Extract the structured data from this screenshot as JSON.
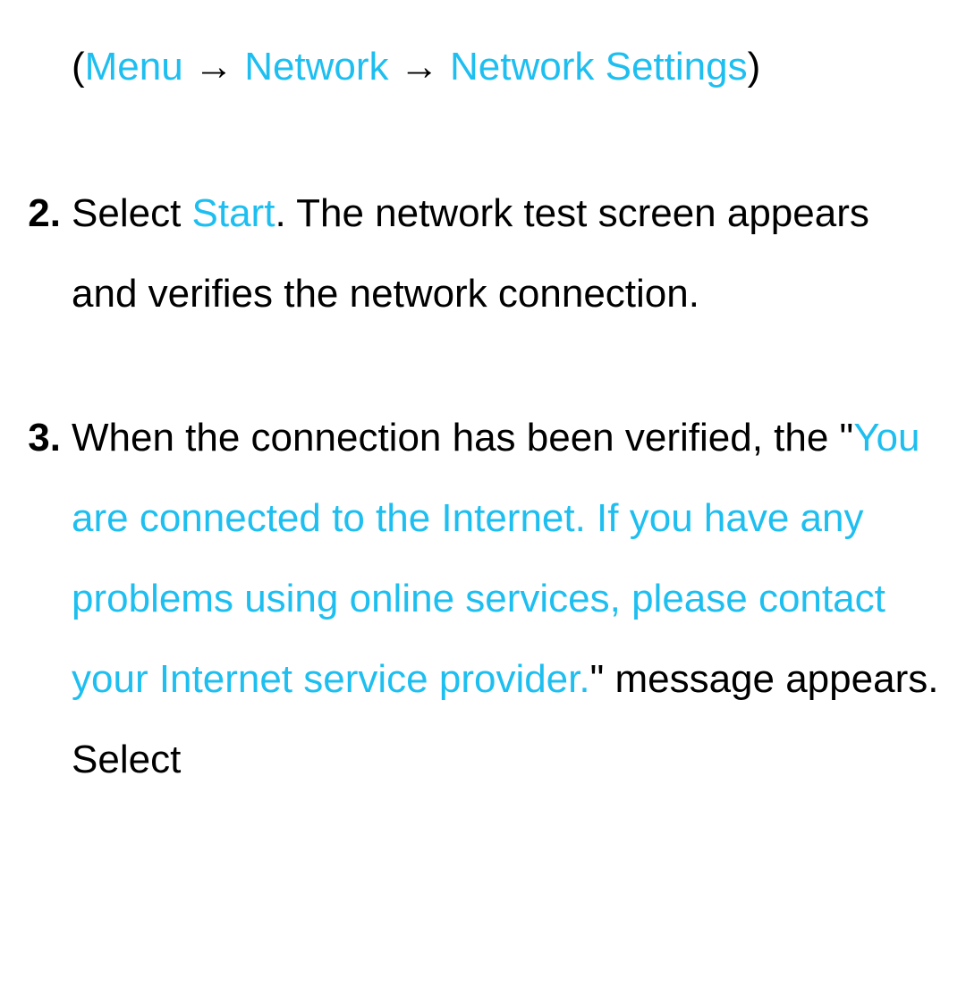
{
  "items": [
    {
      "marker": "",
      "paren_open": "(",
      "hl_menu": "Menu",
      "arrow1": " → ",
      "hl_network": "Network",
      "arrow2": " → ",
      "hl_network_settings": "Network Settings",
      "paren_close": ")"
    },
    {
      "marker": "2.",
      "pre": "Select ",
      "hl_start": "Start",
      "post": ". The network test screen appears and verifies the network connection."
    },
    {
      "marker": "3.",
      "pre": "When the connection has been verified, the \"",
      "hl_message": "You are connected to the Internet. If you have any problems using online services, please contact your Internet service provider.",
      "post": "\" message appears. Select"
    }
  ]
}
